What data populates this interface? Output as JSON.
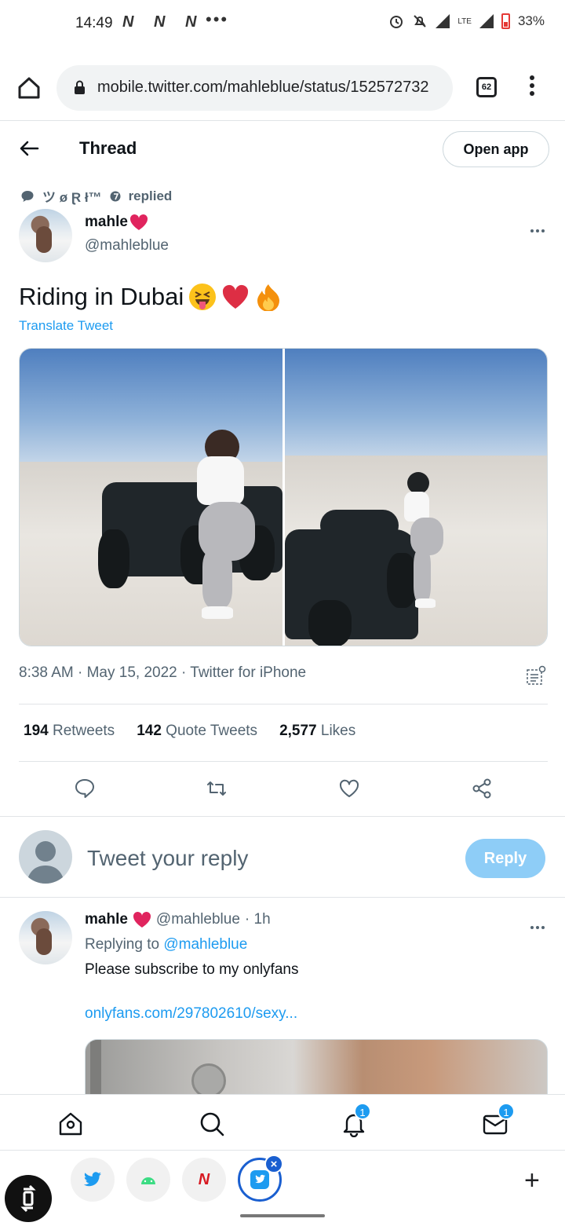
{
  "status_bar": {
    "time": "14:49",
    "notification_icons": "N N N",
    "more": "•••",
    "network": "LTE",
    "battery": "33%"
  },
  "browser": {
    "url": "mobile.twitter.com/mahleblue/status/152572732",
    "tab_count": "62"
  },
  "header": {
    "title": "Thread",
    "open_app": "Open app"
  },
  "tweet": {
    "context_user": "ツ ø Ɽ ł™",
    "context_action": "replied",
    "author_name": "mahle",
    "author_handle": "@mahleblue",
    "text": "Riding in Dubai",
    "translate": "Translate Tweet",
    "meta": "8:38 AM · May 15, 2022 · Twitter for iPhone",
    "stats": {
      "retweets_count": "194",
      "retweets_label": "Retweets",
      "quotes_count": "142",
      "quotes_label": "Quote Tweets",
      "likes_count": "2,577",
      "likes_label": "Likes"
    }
  },
  "composer": {
    "placeholder": "Tweet your reply",
    "reply_button": "Reply"
  },
  "reply": {
    "author_name": "mahle",
    "author_handle": "@mahleblue",
    "time": "· 1h",
    "replying_prefix": "Replying to",
    "replying_to": "@mahleblue",
    "text": "Please subscribe to my onlyfans",
    "link": "onlyfans.com/297802610/sexy..."
  },
  "bottom_nav": {
    "notifications_badge": "1",
    "messages_badge": "1"
  },
  "colors": {
    "accent": "#1d9bf0",
    "reply_button": "#8ecdf7",
    "heart": "#e0245e"
  }
}
